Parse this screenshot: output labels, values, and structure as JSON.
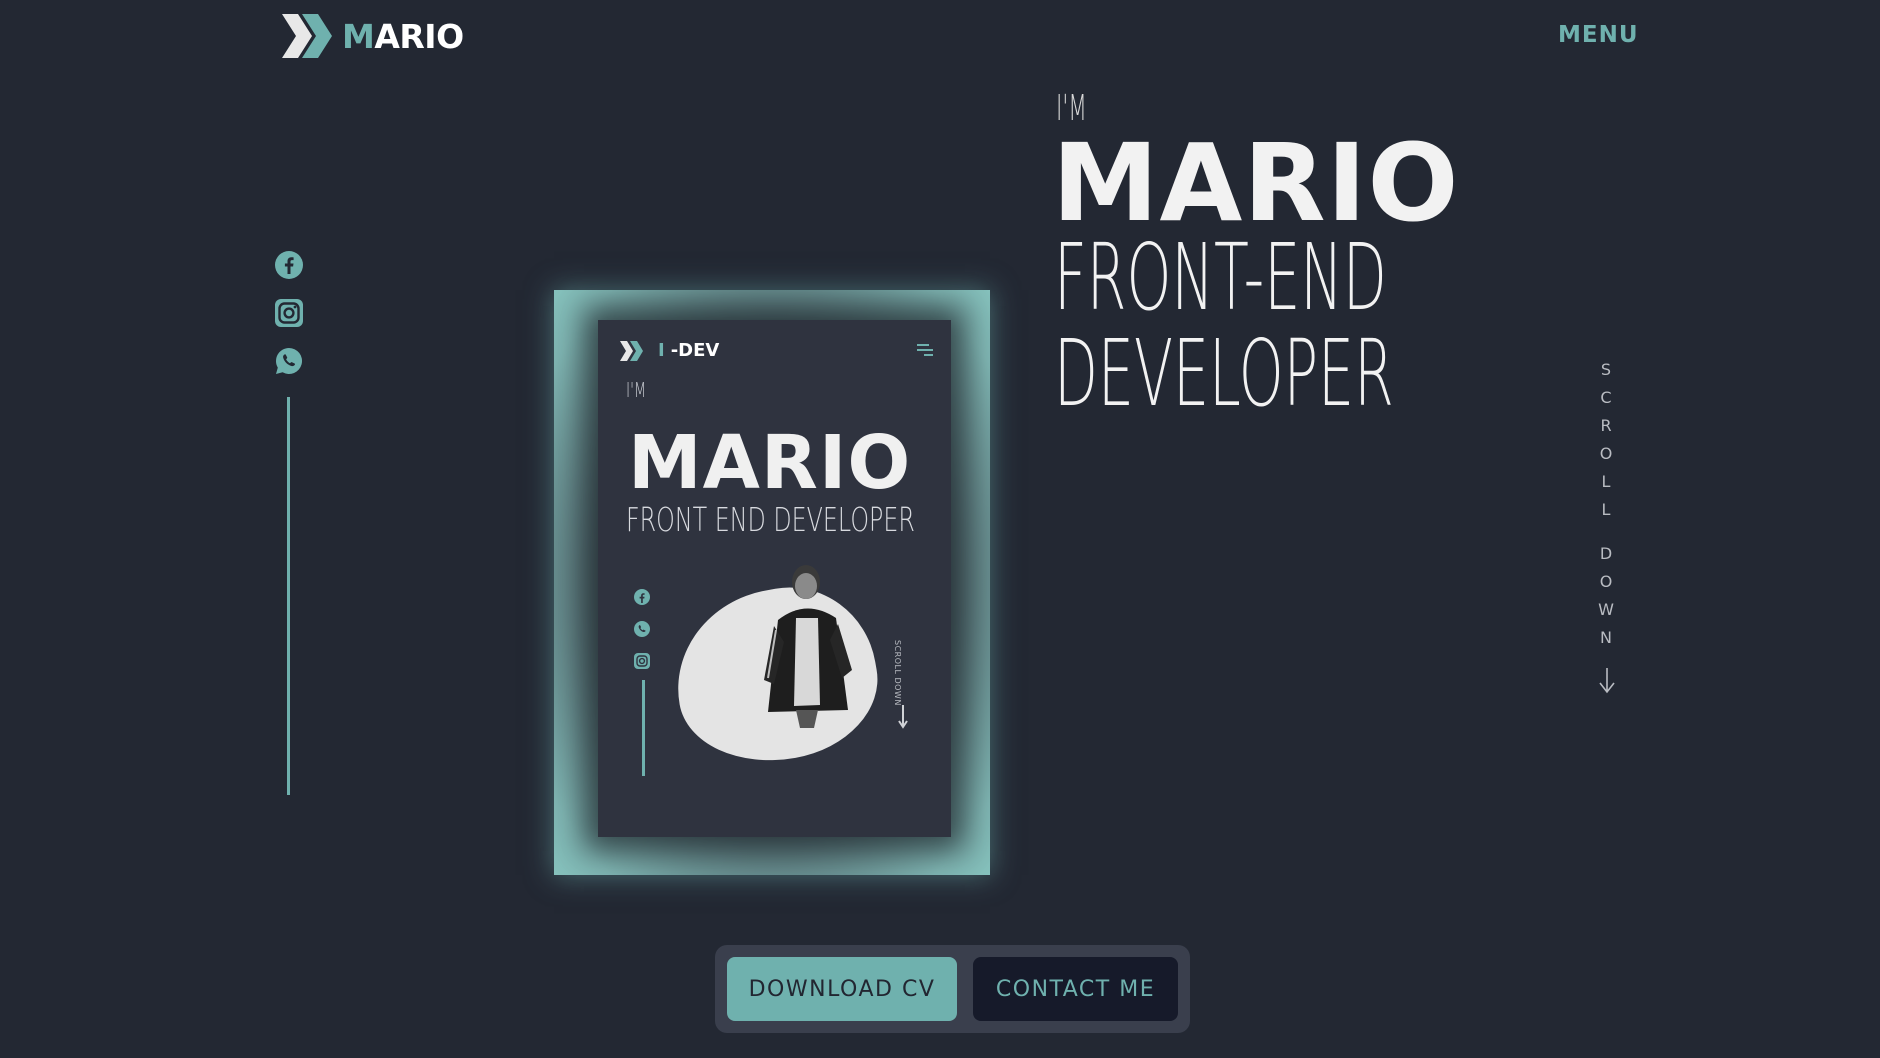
{
  "header": {
    "logo_first": "M",
    "logo_rest": "ARIO",
    "menu_label": "MENU"
  },
  "socials": {
    "icons": [
      "facebook-icon",
      "instagram-icon",
      "whatsapp-icon"
    ]
  },
  "mockup": {
    "logo_first": "I",
    "logo_rest": "-DEV",
    "im": "I'M",
    "name": "MARIO",
    "role": "FRONT END DEVELOPER",
    "scroll": "SCROLL DOWN"
  },
  "hero": {
    "im": "I'M",
    "name": "MARIO",
    "role_line1": "FRONT-END",
    "role_line2": "DEVELOPER"
  },
  "scroll_down": {
    "letters_1": [
      "S",
      "C",
      "R",
      "O",
      "L",
      "L"
    ],
    "letters_2": [
      "D",
      "O",
      "W",
      "N"
    ]
  },
  "buttons": {
    "download": "DOWNLOAD CV",
    "contact": "CONTACT ME"
  },
  "colors": {
    "background": "#232833",
    "accent": "#6fb1ae",
    "contact_button_bg": "#161a2a"
  }
}
